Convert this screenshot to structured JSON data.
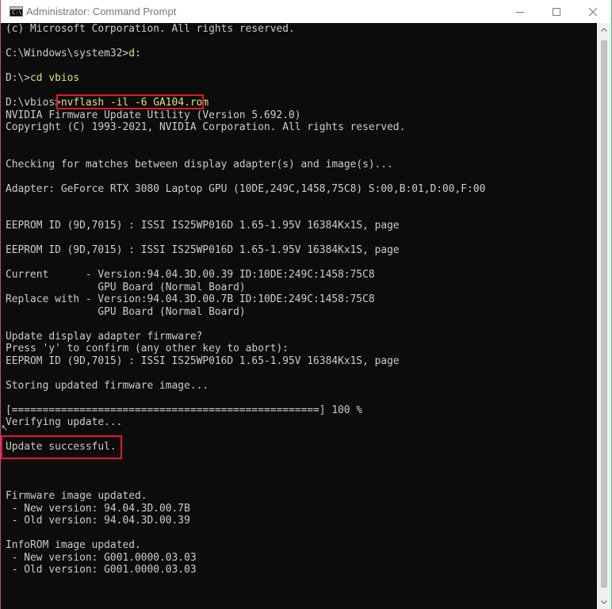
{
  "window": {
    "title": "Administrator: Command Prompt",
    "app_icon_text": "C:\\"
  },
  "console": {
    "lines": [
      "(c) Microsoft Corporation. All rights reserved.",
      "",
      "C:\\Windows\\system32>",
      "",
      "D:\\>",
      "",
      "D:\\vbios>",
      "NVIDIA Firmware Update Utility (Version 5.692.0)",
      "Copyright (C) 1993-2021, NVIDIA Corporation. All rights reserved.",
      "",
      "",
      "Checking for matches between display adapter(s) and image(s)...",
      "",
      "Adapter: GeForce RTX 3080 Laptop GPU (10DE,249C,1458,75C8) S:00,B:01,D:00,F:00",
      "",
      "",
      "EEPROM ID (9D,7015) : ISSI IS25WP016D 1.65-1.95V 16384Kx1S, page",
      "",
      "EEPROM ID (9D,7015) : ISSI IS25WP016D 1.65-1.95V 16384Kx1S, page",
      "",
      "Current      - Version:94.04.3D.00.39 ID:10DE:249C:1458:75C8",
      "               GPU Board (Normal Board)",
      "Replace with - Version:94.04.3D.00.7B ID:10DE:249C:1458:75C8",
      "               GPU Board (Normal Board)",
      "",
      "Update display adapter firmware?",
      "Press 'y' to confirm (any other key to abort):",
      "EEPROM ID (9D,7015) : ISSI IS25WP016D 1.65-1.95V 16384Kx1S, page",
      "",
      "Storing updated firmware image...",
      "",
      "[==================================================] 100 %",
      "Verifying update...",
      "",
      "Update successful.",
      "",
      "",
      "",
      "Firmware image updated.",
      " - New version: 94.04.3D.00.7B",
      " - Old version: 94.04.3D.00.39",
      "",
      "InfoROM image updated.",
      " - New version: G001.0000.03.03",
      " - Old version: G001.0000.03.03"
    ],
    "commands": {
      "2": "d:",
      "4": "cd vbios",
      "6": "nvflash -il -6 GA104.rom"
    }
  },
  "colors": {
    "console_bg": "#0c0c0c",
    "console_text": "#cccccc",
    "command_text": "#e5e072",
    "highlight_border": "#e0192c"
  },
  "icons": {
    "app": "command-prompt-icon",
    "minimize": "minimize-icon",
    "maximize": "maximize-icon",
    "close": "close-icon",
    "scroll_up": "chevron-up-icon",
    "scroll_down": "chevron-down-icon",
    "cursor": "mouse-cursor-icon"
  }
}
